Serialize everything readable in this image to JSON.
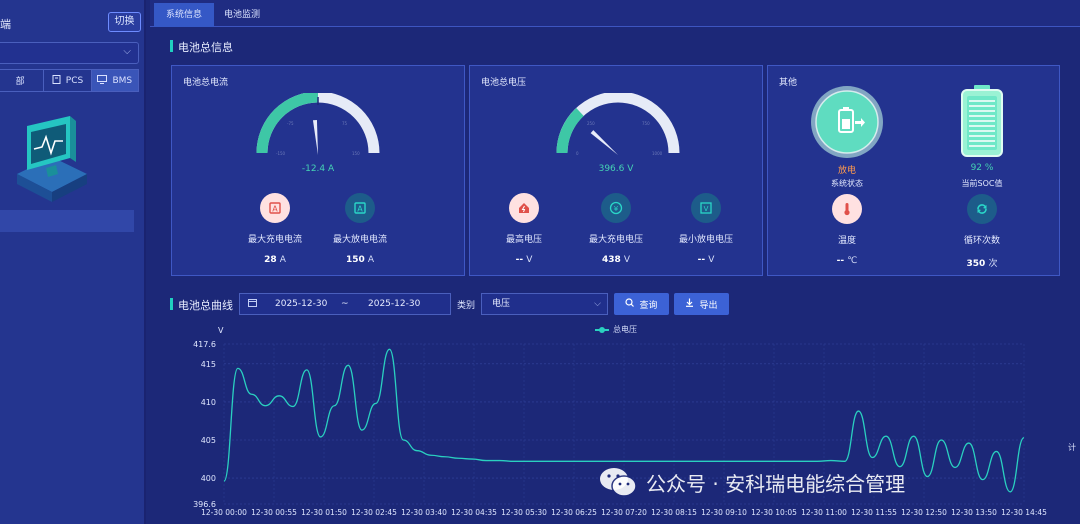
{
  "sidebar": {
    "title": "端",
    "switch_label": "切换",
    "tabs": [
      {
        "label": "部",
        "icon": "list-icon"
      },
      {
        "label": "PCS",
        "icon": "device-icon"
      },
      {
        "label": "BMS",
        "icon": "monitor-icon"
      }
    ]
  },
  "top_tabs": [
    {
      "label": "系统信息",
      "active": true
    },
    {
      "label": "电池监测",
      "active": false
    }
  ],
  "battery_info": {
    "section_title": "电池总信息",
    "current_panel": {
      "title": "电池总电流",
      "gauge_value": "-12.4 A",
      "metrics": [
        {
          "label": "最大充电电流",
          "value": "28",
          "unit": "A",
          "icon": "charge-icon"
        },
        {
          "label": "最大放电电流",
          "value": "150",
          "unit": "A",
          "icon": "discharge-icon"
        }
      ]
    },
    "voltage_panel": {
      "title": "电池总电压",
      "gauge_value": "396.6 V",
      "metrics": [
        {
          "label": "最高电压",
          "value": "--",
          "unit": "V",
          "icon": "home-voltage-icon"
        },
        {
          "label": "最大充电电压",
          "value": "438",
          "unit": "V",
          "icon": "yen-circle-icon"
        },
        {
          "label": "最小放电电压",
          "value": "--",
          "unit": "V",
          "icon": "battery-down-icon"
        }
      ]
    },
    "other_panel": {
      "title": "其他",
      "status_value": "放电",
      "status_label": "系统状态",
      "soc_value": "92 %",
      "soc_label": "当前SOC值",
      "soc_fraction": 0.92,
      "metrics": [
        {
          "label": "温度",
          "value": "--",
          "unit": "℃",
          "icon": "thermometer-icon"
        },
        {
          "label": "循环次数",
          "value": "350",
          "unit": "次",
          "icon": "cycle-icon"
        }
      ]
    }
  },
  "curve": {
    "section_title": "电池总曲线",
    "date_start": "2025-12-30",
    "date_sep": "~",
    "date_end": "2025-12-30",
    "type_label": "类别",
    "type_value": "电压",
    "query_label": "查询",
    "export_label": "导出"
  },
  "watermark": "公众号 · 安科瑞电能综合管理",
  "chart_data": {
    "type": "line",
    "ylabel": "V",
    "ylim": [
      396.6,
      417.6
    ],
    "y_ticks": [
      "417.6",
      "415",
      "410",
      "405",
      "400",
      "396.6"
    ],
    "x_ticks": [
      "12-30 00:00",
      "12-30 00:55",
      "12-30 01:50",
      "12-30 02:45",
      "12-30 03:40",
      "12-30 04:35",
      "12-30 05:30",
      "12-30 06:25",
      "12-30 07:20",
      "12-30 08:15",
      "12-30 09:10",
      "12-30 10:05",
      "12-30 11:00",
      "12-30 11:55",
      "12-30 12:50",
      "12-30 13:50",
      "12-30 14:45"
    ],
    "right_label": "计",
    "series": [
      {
        "name": "总电压",
        "color": "#2ad0c0",
        "values": [
          399.6,
          414.4,
          411,
          409.5,
          410.8,
          409.4,
          414.2,
          405.4,
          409.5,
          414.8,
          406.3,
          409.8,
          416.9,
          405,
          403.6,
          403,
          402.8,
          402.6,
          402.5,
          402.3,
          402.3,
          402.2,
          402.2,
          402.2,
          402.2,
          402.2,
          402.2,
          402.2,
          402.2,
          402.2,
          402.2,
          402.2,
          402.2,
          402.2,
          402.2,
          402.2,
          402.2,
          402.2,
          402.2,
          402.2,
          402.2,
          402.2,
          402.2,
          402.2,
          402.3,
          402.2,
          408.8,
          402.7,
          405.5,
          401.5,
          405.5,
          400.2,
          405,
          401.4,
          404.6,
          399.8,
          403.5,
          398.2,
          405.3
        ]
      }
    ]
  }
}
